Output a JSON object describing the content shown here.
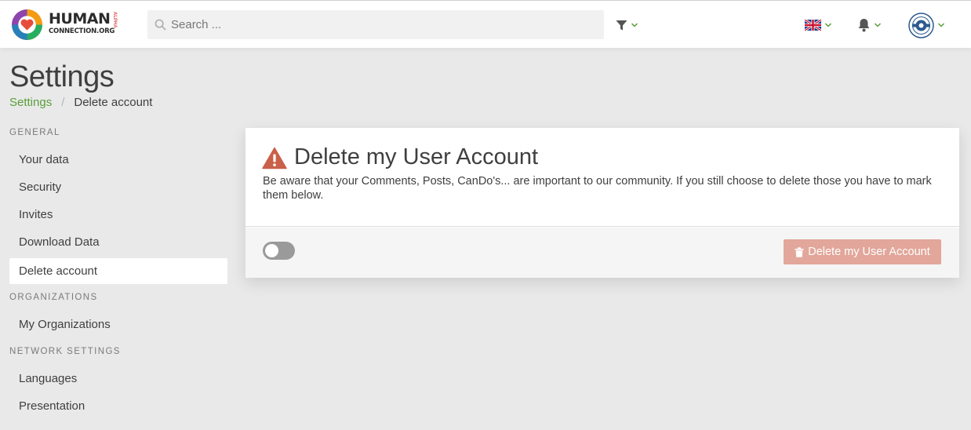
{
  "header": {
    "logo_title": "HUMAN",
    "logo_subtitle": "CONNECTION.ORG",
    "logo_badge": "ALPHA",
    "search_placeholder": "Search ...",
    "icons": [
      "filter-icon",
      "uk-flag-icon",
      "bell-icon",
      "avatar"
    ],
    "accent_color": "#5a9e3a"
  },
  "page": {
    "title": "Settings",
    "breadcrumb": {
      "link": "Settings",
      "separator": "/",
      "current": "Delete account"
    }
  },
  "sidebar": {
    "sections": [
      {
        "label": "GENERAL",
        "items": [
          "Your data",
          "Security",
          "Invites",
          "Download Data",
          "Delete account"
        ]
      },
      {
        "label": "ORGANIZATIONS",
        "items": [
          "My Organizations"
        ]
      },
      {
        "label": "NETWORK SETTINGS",
        "items": [
          "Languages",
          "Presentation"
        ]
      }
    ],
    "active_item": "Delete account"
  },
  "card": {
    "title": "Delete my User Account",
    "description": "Be aware that your Comments, Posts, CanDo's... are important to our community. If you still choose to delete those you have to mark them below.",
    "toggle_on": false,
    "delete_button_label": "Delete my User Account",
    "danger_color": "#c9604a",
    "disabled_button_color": "#e2a69a"
  }
}
